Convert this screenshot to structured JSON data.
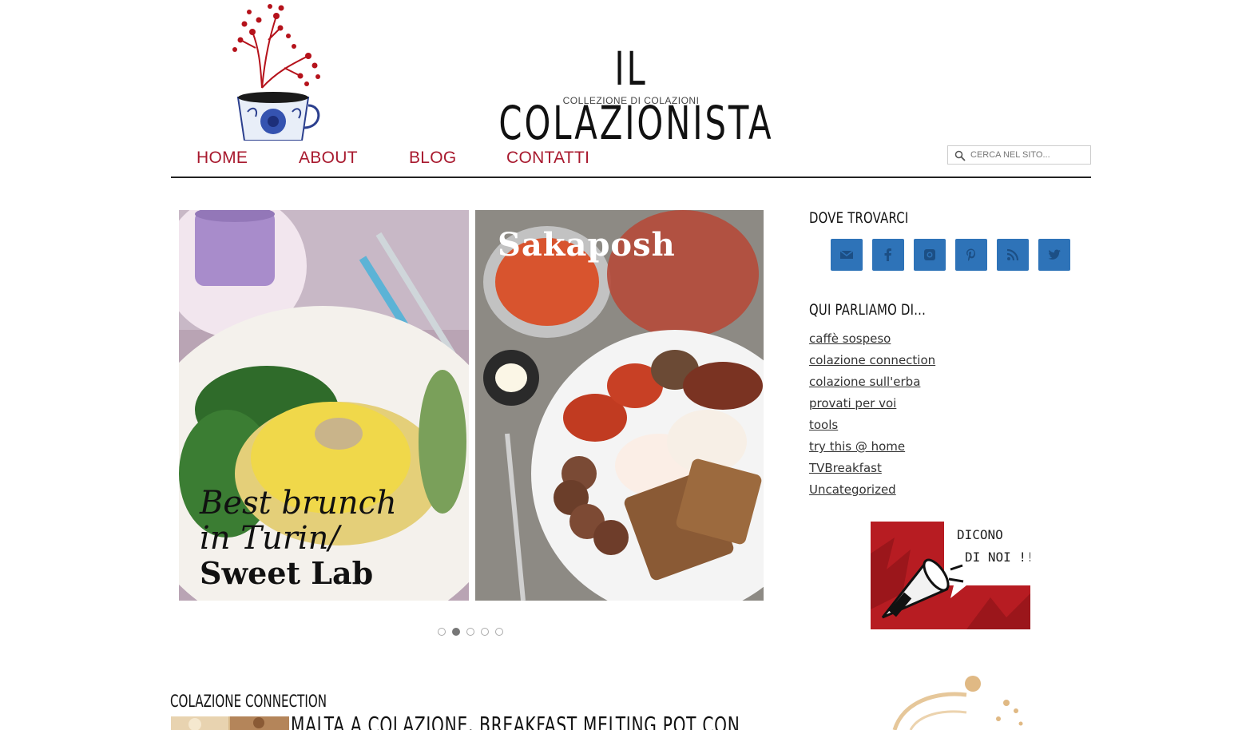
{
  "header": {
    "title": "IL COLAZIONISTA",
    "subtitle": "COLLEZIONE DI COLAZIONI",
    "logo_icon": "teacup-with-berry-branch-icon"
  },
  "nav": {
    "items": [
      {
        "label": "HOME"
      },
      {
        "label": "ABOUT"
      },
      {
        "label": "BLOG"
      },
      {
        "label": "CONTATTI"
      }
    ],
    "search_placeholder": "CERCA NEL SITO...",
    "accent_color": "#a8192e"
  },
  "slider": {
    "slides": [
      {
        "title_line1": "Best brunch",
        "title_line2": "in Turin/",
        "title_line3": "Sweet Lab"
      },
      {
        "title": "Sakaposh"
      }
    ],
    "dot_count": 5,
    "active_dot": 1
  },
  "sidebar": {
    "find_us_title": "DOVE TROVARCI",
    "social": [
      {
        "icon": "email-icon"
      },
      {
        "icon": "facebook-icon"
      },
      {
        "icon": "instagram-icon"
      },
      {
        "icon": "pinterest-icon"
      },
      {
        "icon": "rss-icon"
      },
      {
        "icon": "twitter-icon"
      }
    ],
    "social_color": "#2e73b8",
    "categories_title": "QUI PARLIAMO DI...",
    "categories": [
      {
        "label": "caffè sospeso"
      },
      {
        "label": "colazione connection"
      },
      {
        "label": "colazione sull'erba"
      },
      {
        "label": "provati per voi"
      },
      {
        "label": "tools"
      },
      {
        "label": "try this @ home"
      },
      {
        "label": "TVBreakfast"
      },
      {
        "label": "Uncategorized"
      }
    ],
    "press_banner": {
      "line1": "DICONO",
      "line2": "DI NOI !!"
    }
  },
  "content": {
    "section_title": "COLAZIONE CONNECTION",
    "post_title": "MALTA A COLAZIONE, BREAKFAST MELTING POT CON"
  }
}
